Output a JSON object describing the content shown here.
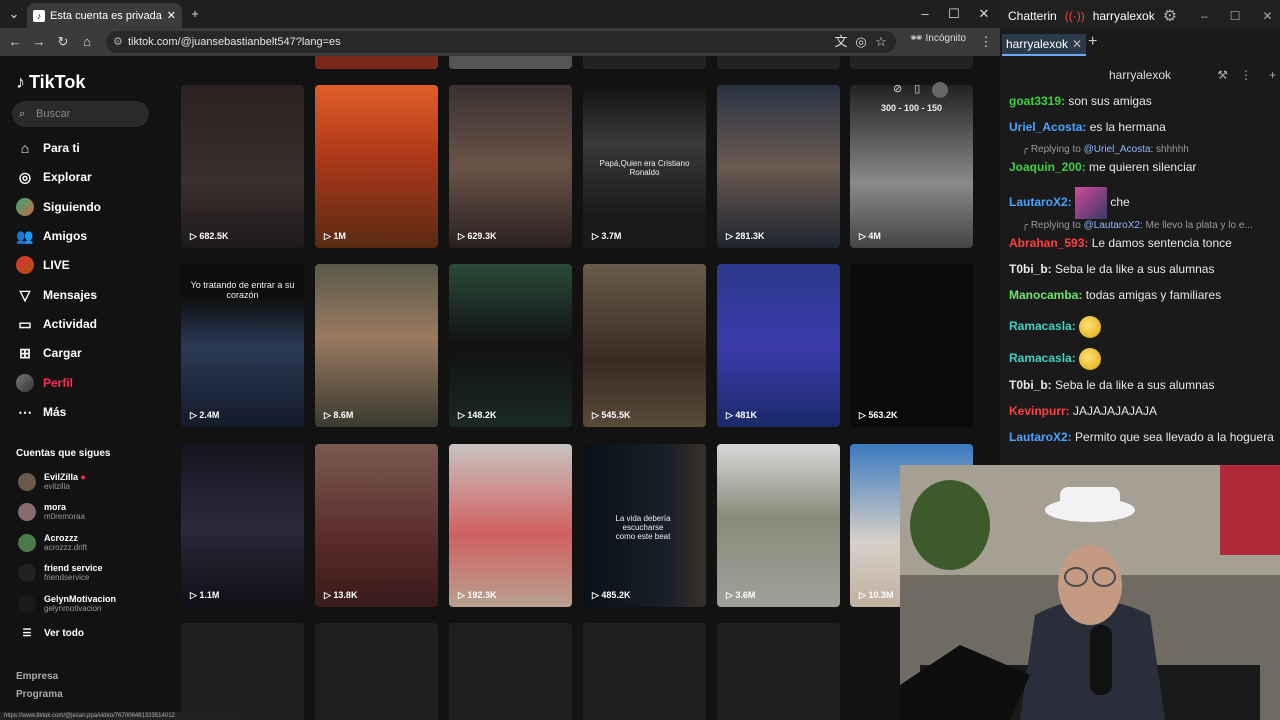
{
  "browser": {
    "tab_title": "Esta cuenta es privada. Sigue e",
    "url": "tiktok.com/@juansebastianbelt547?lang=es",
    "incognito_label": "Incógnito"
  },
  "tiktok": {
    "logo": "TikTok",
    "search_placeholder": "Buscar",
    "nav": [
      {
        "label": "Para ti",
        "icon": "home-icon"
      },
      {
        "label": "Explorar",
        "icon": "compass-icon"
      },
      {
        "label": "Siguiendo",
        "icon": "following-avatar"
      },
      {
        "label": "Amigos",
        "icon": "friends-icon"
      },
      {
        "label": "LIVE",
        "icon": "live-avatar"
      },
      {
        "label": "Mensajes",
        "icon": "messages-icon"
      },
      {
        "label": "Actividad",
        "icon": "activity-icon"
      },
      {
        "label": "Cargar",
        "icon": "upload-icon"
      },
      {
        "label": "Perfil",
        "icon": "profile-avatar"
      },
      {
        "label": "Más",
        "icon": "more-icon"
      }
    ],
    "following_heading": "Cuentas que sigues",
    "following": [
      {
        "name": "EvilZilla",
        "handle": "evilzilla"
      },
      {
        "name": "mora",
        "handle": "m0remoraa"
      },
      {
        "name": "Acrozzz",
        "handle": "acrozzz.drift"
      },
      {
        "name": "friend service",
        "handle": "friendservice"
      },
      {
        "name": "GelynMotivacion",
        "handle": "gelynmotivacion"
      }
    ],
    "see_all": "Ver todo",
    "footer": [
      "Empresa",
      "Programa"
    ],
    "videos": [
      {
        "views": "682.5K",
        "caption": ""
      },
      {
        "views": "1M",
        "caption": ""
      },
      {
        "views": "629.3K",
        "caption": ""
      },
      {
        "views": "3.7M",
        "caption": "Papá,Quien era Cristiano Ronaldo"
      },
      {
        "views": "281.3K",
        "caption": ""
      },
      {
        "views": "4M",
        "caption": "300 - 100 - 150"
      },
      {
        "views": "2.4M",
        "caption": "Yo tratando de entrar a su corazón"
      },
      {
        "views": "8.6M",
        "caption": ""
      },
      {
        "views": "148.2K",
        "caption": ""
      },
      {
        "views": "545.5K",
        "caption": ""
      },
      {
        "views": "481K",
        "caption": ""
      },
      {
        "views": "563.2K",
        "caption": ""
      },
      {
        "views": "1.1M",
        "caption": ""
      },
      {
        "views": "13.8K",
        "caption": ""
      },
      {
        "views": "192.3K",
        "caption": ""
      },
      {
        "views": "485.2K",
        "caption": "La vida debería escucharse como este beat"
      },
      {
        "views": "3.6M",
        "caption": ""
      },
      {
        "views": "10.3M",
        "caption": ""
      }
    ],
    "status_url": "https://www.tiktok.com/@jesan.ppa/video/767006481333514012"
  },
  "chat": {
    "app_title": "Chatterin",
    "channel": "harryalexok",
    "tab": "harryalexok",
    "header": "harryalexok",
    "messages": [
      {
        "user": "goat3319:",
        "text": "son sus amigas",
        "color": "#3fd13f"
      },
      {
        "user": "Uriel_Acosta:",
        "text": "es la hermana",
        "color": "#4aa3ff"
      },
      {
        "reply": "Replying to",
        "mention": "@Uriel_Acosta:",
        "quote": "shhhhh"
      },
      {
        "user": "Joaquin_200:",
        "text": "me quieren silenciar",
        "color": "#3fd13f"
      },
      {
        "user": "LautaroX2:",
        "text": "che",
        "color": "#4aa3ff"
      },
      {
        "reply": "Replying to",
        "mention": "@LautaroX2:",
        "quote": "Me llevo la plata y lo e..."
      },
      {
        "user": "Abrahan_593:",
        "text": "Le damos sentencia tonce",
        "color": "#ff4040"
      },
      {
        "user": "T0bi_b:",
        "text": "Seba le da like a sus alumnas",
        "color": "#e8e8e8"
      },
      {
        "user": "Manocamba:",
        "text": "todas amigas y familiares",
        "color": "#6fe26f"
      },
      {
        "user": "Ramacasla:",
        "text": "",
        "color": "#3fd1c4"
      },
      {
        "user": "Ramacasla:",
        "text": "",
        "color": "#3fd1c4"
      },
      {
        "user": "T0bi_b:",
        "text": "Seba le da like a sus alumnas",
        "color": "#e8e8e8"
      },
      {
        "user": "Kevinpurr:",
        "text": "JAJAJAJAJAJA",
        "color": "#ff4040"
      },
      {
        "user": "LautaroX2:",
        "text": "Permito que sea llevado a la hoguera",
        "color": "#4aa3ff"
      }
    ]
  }
}
